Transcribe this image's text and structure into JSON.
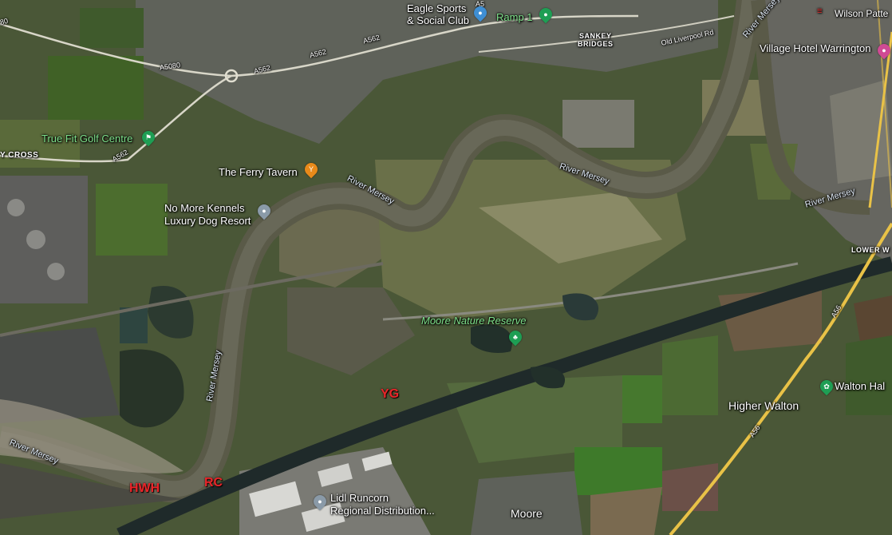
{
  "map": {
    "colors": {
      "river": "#5a5a46",
      "water": "#2e3a34",
      "fields_light": "#6e7a4c",
      "fields_dark": "#3a4a2a",
      "urban": "#6b6b66",
      "road_major": "#e9c247",
      "canal": "#1f2a2a"
    },
    "places": {
      "eagle_sports_line1": "Eagle Sports",
      "eagle_sports_line2": "& Social Club",
      "ramp1": "Ramp 1",
      "sankey_bridges_line1": "SANKEY",
      "sankey_bridges_line2": "BRIDGES",
      "village_hotel": "Village Hotel Warrington",
      "wilson_patten": "Wilson Patte",
      "true_fit": "True Fit Golf Centre",
      "cross": "Y CROSS",
      "ferry_tavern": "The Ferry Tavern",
      "no_more_kennels_line1": "No More Kennels",
      "no_more_kennels_line2": "Luxury Dog Resort",
      "moore_reserve": "Moore Nature Reserve",
      "walton_hall": "Walton Hal",
      "higher_walton": "Higher Walton",
      "lower_walton": "LOWER W",
      "lidl_line1": "Lidl Runcorn",
      "lidl_line2": "Regional Distribution...",
      "moore": "Moore"
    },
    "roads": {
      "a5080": "A5080",
      "a562_a": "A562",
      "a562_b": "A562",
      "a562_c": "A562",
      "a562_d": "A562",
      "a56_a": "A56",
      "a56_b": "A56",
      "a5_top": "A5",
      "old_liverpool_rd": "Old Liverpool Rd",
      "road_80": "80"
    },
    "rivers": {
      "r1": "River Mersey",
      "r2": "River Mersey",
      "r3": "River Mersey",
      "r4": "River Mersey",
      "r5": "River Mersey",
      "r6": "River Mersey"
    },
    "markers": {
      "hwh": "HWH",
      "rc": "RC",
      "yg": "YG"
    },
    "icons": {
      "eagle": "sports-pin-icon",
      "ramp": "park-pin-icon",
      "golf": "golf-pin-icon",
      "tavern": "bar-pin-icon",
      "kennels": "place-pin-icon",
      "reserve": "tree-pin-icon",
      "walton": "park-pin-icon",
      "lidl": "place-pin-icon",
      "hotel": "hotel-pin-icon",
      "station": "rail-icon"
    }
  }
}
